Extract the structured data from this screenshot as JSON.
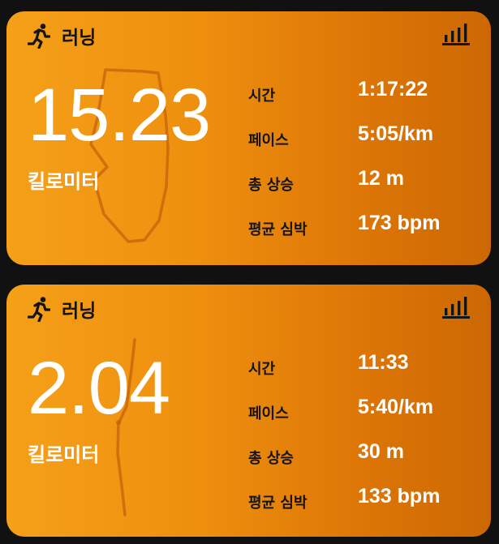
{
  "cards": [
    {
      "activity": "러닝",
      "icon": "running-icon",
      "chart_icon": "bar-chart-icon",
      "distance": "15.23",
      "unit": "킬로미터",
      "stats": [
        {
          "label": "시간",
          "value": "1:17:22"
        },
        {
          "label": "페이스",
          "value": "5:05/km"
        },
        {
          "label": "총 상승",
          "value": "12 m"
        },
        {
          "label": "평균 심박",
          "value": "173 bpm"
        }
      ]
    },
    {
      "activity": "러닝",
      "icon": "running-icon",
      "chart_icon": "bar-chart-icon",
      "distance": "2.04",
      "unit": "킬로미터",
      "stats": [
        {
          "label": "시간",
          "value": "11:33"
        },
        {
          "label": "페이스",
          "value": "5:40/km"
        },
        {
          "label": "총 상승",
          "value": "30 m"
        },
        {
          "label": "평균 심박",
          "value": "133 bpm"
        }
      ]
    }
  ],
  "colors": {
    "background": "#111111",
    "card_gradient_start": "#f5a019",
    "card_gradient_end": "#cc6803",
    "route_line": "#c4620a",
    "text_primary": "#ffffff",
    "text_dark": "#141414"
  }
}
